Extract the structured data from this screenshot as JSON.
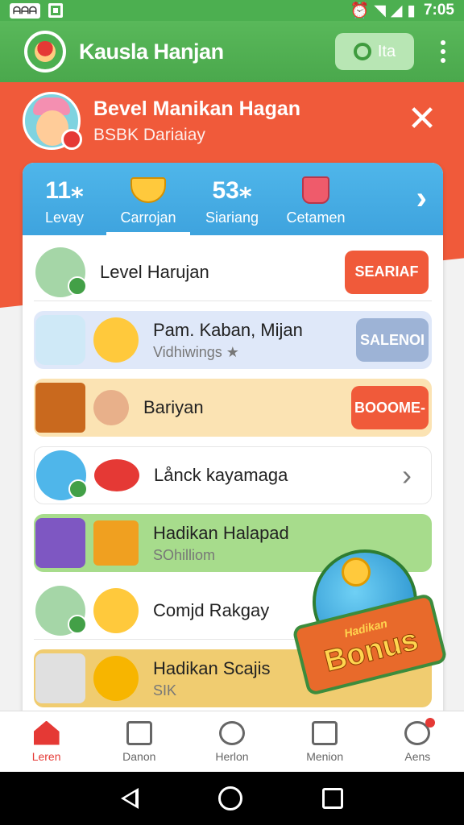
{
  "status_bar": {
    "left_badge": "ᗩᗩᗩ",
    "time": "7:05"
  },
  "app_bar": {
    "title": "Kausla Hanjan",
    "pill_label": "Ita"
  },
  "profile": {
    "name": "Bevel Manikan Hagan",
    "subtitle": "BSBK Dariaiay"
  },
  "tabs": [
    {
      "top": "11⁎",
      "label": "Levay"
    },
    {
      "top": "",
      "label": "Carrojan"
    },
    {
      "top": "53⁎",
      "label": "Siariang"
    },
    {
      "top": "",
      "label": "Cetamen"
    }
  ],
  "rows": [
    {
      "title": "Level Harujan",
      "subtitle": "",
      "action": "SEARIAF"
    },
    {
      "title": "Pam. Kaban, Mijan",
      "subtitle": "Vidhiwings ★",
      "action": "SALENOI"
    },
    {
      "title": "Bariyan",
      "subtitle": "",
      "action": "BOOOME-"
    },
    {
      "title": "Lånck kayamaga",
      "subtitle": "",
      "action": ""
    },
    {
      "title": "Hadikan Halapad",
      "subtitle": "SOhilliom",
      "action": ""
    },
    {
      "title": "Comjd Rakgay",
      "subtitle": "",
      "action": ""
    },
    {
      "title": "Hadikan Scajis",
      "subtitle": "SIK",
      "action": ""
    }
  ],
  "bonus": {
    "small": "Hadikan",
    "big": "Bonus"
  },
  "bottom_nav": [
    {
      "label": "Leren"
    },
    {
      "label": "Danon"
    },
    {
      "label": "Herlon"
    },
    {
      "label": "Menion"
    },
    {
      "label": "Aens"
    }
  ],
  "colors": {
    "green": "#4caf50",
    "orange": "#f05a3a",
    "blue": "#3ea3de"
  }
}
